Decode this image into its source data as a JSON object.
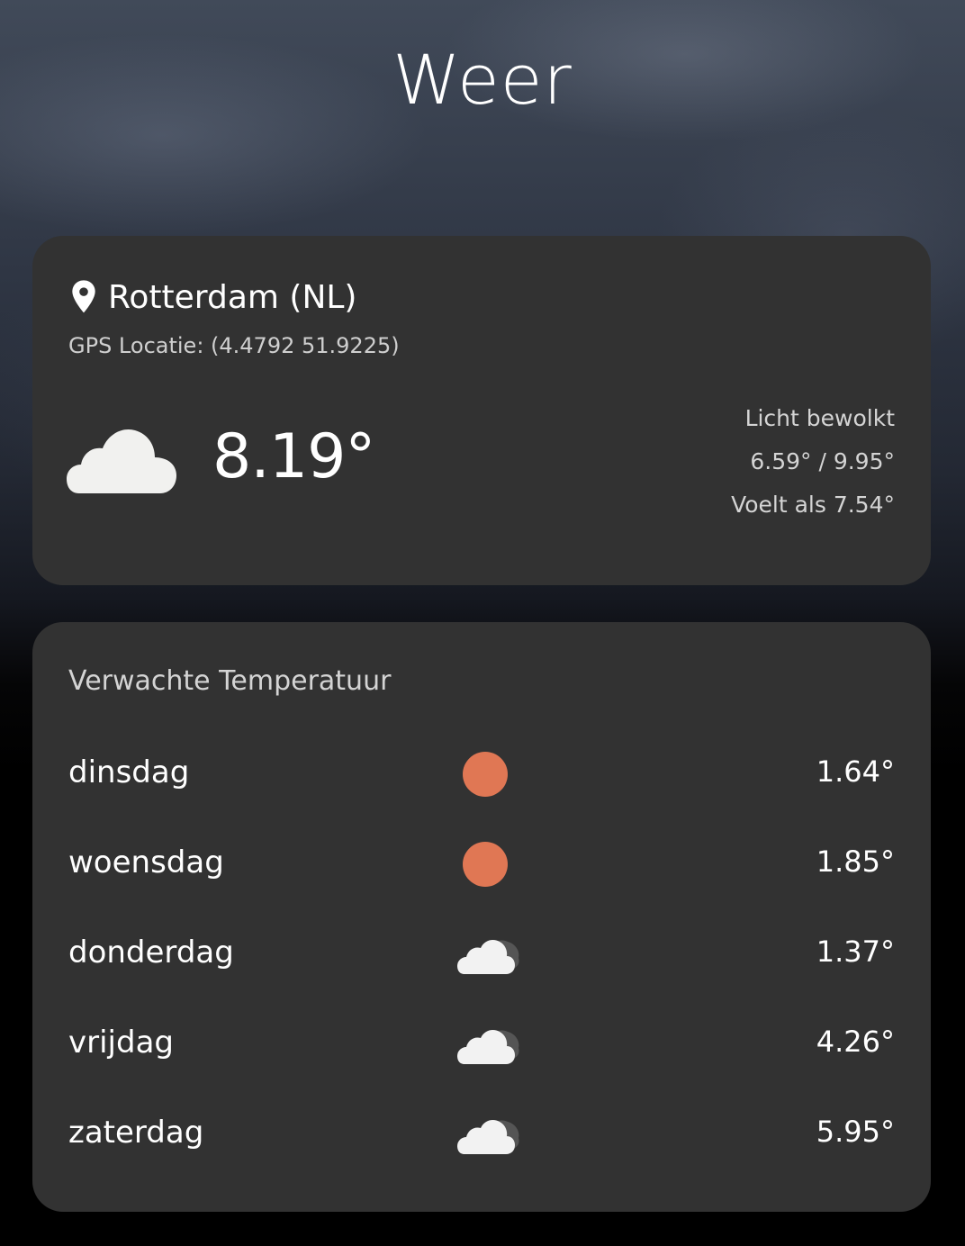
{
  "app": {
    "title": "Weer"
  },
  "current": {
    "location": "Rotterdam (NL)",
    "location_icon": "map-pin-icon",
    "gps": "GPS Locatie: (4.4792 51.9225)",
    "weather_icon": "cloud-icon",
    "temperature": "8.19°",
    "description": "Licht bewolkt",
    "min_max": "6.59° / 9.95°",
    "feels_like": "Voelt als 7.54°"
  },
  "forecast": {
    "heading": "Verwachte Temperatuur",
    "days": [
      {
        "day": "dinsdag",
        "icon": "sun-icon",
        "temp": "1.64°"
      },
      {
        "day": "woensdag",
        "icon": "sun-icon",
        "temp": "1.85°"
      },
      {
        "day": "donderdag",
        "icon": "clouds-icon",
        "temp": "1.37°"
      },
      {
        "day": "vrijdag",
        "icon": "clouds-icon",
        "temp": "4.26°"
      },
      {
        "day": "zaterdag",
        "icon": "clouds-icon",
        "temp": "5.95°"
      }
    ]
  },
  "colors": {
    "card_background": "#323232",
    "sun": "#e07754",
    "cloud": "#f2f2f2",
    "cloud_shadow": "#555555"
  }
}
